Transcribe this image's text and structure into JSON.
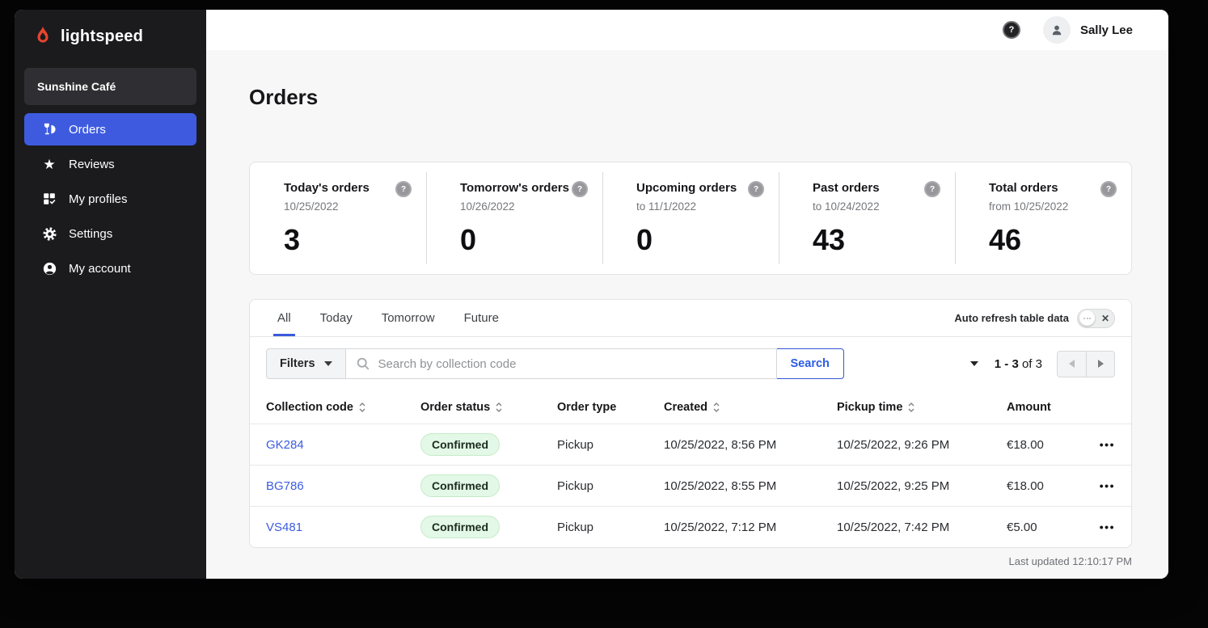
{
  "sidebar": {
    "logo_text": "lightspeed",
    "business_name": "Sunshine Café",
    "items": [
      {
        "label": "Orders",
        "icon": "orders-icon",
        "active": true
      },
      {
        "label": "Reviews",
        "icon": "reviews-icon",
        "active": false
      },
      {
        "label": "My profiles",
        "icon": "profiles-icon",
        "active": false
      },
      {
        "label": "Settings",
        "icon": "settings-icon",
        "active": false
      },
      {
        "label": "My account",
        "icon": "account-icon",
        "active": false
      }
    ]
  },
  "topbar": {
    "help_icon": "?",
    "user_name": "Sally Lee"
  },
  "page": {
    "title": "Orders"
  },
  "stats": [
    {
      "label": "Today's orders",
      "sublabel": "10/25/2022",
      "value": "3"
    },
    {
      "label": "Tomorrow's orders",
      "sublabel": "10/26/2022",
      "value": "0"
    },
    {
      "label": "Upcoming orders",
      "sublabel": "to 11/1/2022",
      "value": "0"
    },
    {
      "label": "Past orders",
      "sublabel": "to 10/24/2022",
      "value": "43"
    },
    {
      "label": "Total orders",
      "sublabel": "from 10/25/2022",
      "value": "46"
    }
  ],
  "tabs": [
    {
      "label": "All",
      "active": true
    },
    {
      "label": "Today",
      "active": false
    },
    {
      "label": "Tomorrow",
      "active": false
    },
    {
      "label": "Future",
      "active": false
    }
  ],
  "auto_refresh": {
    "label": "Auto refresh table data",
    "state": "off",
    "close_glyph": "✕"
  },
  "filters": {
    "button_label": "Filters",
    "search_placeholder": "Search by collection code",
    "search_button_label": "Search"
  },
  "pagination": {
    "range": "1 - 3",
    "total": "of 3"
  },
  "table": {
    "columns": [
      {
        "label": "Collection code",
        "sortable": true
      },
      {
        "label": "Order status",
        "sortable": true
      },
      {
        "label": "Order type",
        "sortable": false
      },
      {
        "label": "Created",
        "sortable": true
      },
      {
        "label": "Pickup time",
        "sortable": true
      },
      {
        "label": "Amount",
        "sortable": false
      }
    ],
    "rows": [
      {
        "collection_code": "GK284",
        "order_status": "Confirmed",
        "order_type": "Pickup",
        "created": "10/25/2022, 8:56 PM",
        "pickup_time": "10/25/2022, 9:26 PM",
        "amount": "€18.00",
        "menu": "•••"
      },
      {
        "collection_code": "BG786",
        "order_status": "Confirmed",
        "order_type": "Pickup",
        "created": "10/25/2022, 8:55 PM",
        "pickup_time": "10/25/2022, 9:25 PM",
        "amount": "€18.00",
        "menu": "•••"
      },
      {
        "collection_code": "VS481",
        "order_status": "Confirmed",
        "order_type": "Pickup",
        "created": "10/25/2022, 7:12 PM",
        "pickup_time": "10/25/2022, 7:42 PM",
        "amount": "€5.00",
        "menu": "•••"
      }
    ]
  },
  "footer": {
    "last_updated": "Last updated 12:10:17 PM"
  },
  "colors": {
    "accent_blue": "#3b5bdb",
    "link_blue": "#3c5ce0",
    "sidebar_bg": "#1b1b1e",
    "badge_green_bg": "#e3f8e6",
    "badge_green_border": "#c5ebc9",
    "logo_red": "#e8452e",
    "page_bg": "#f7f7f8"
  }
}
